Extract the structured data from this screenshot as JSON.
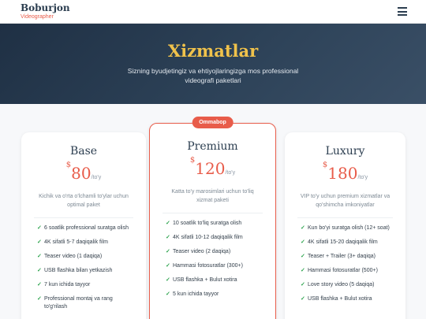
{
  "brand": {
    "name": "Boburjon",
    "tagline": "Videographer"
  },
  "header": {
    "menu_icon": "hamburger-menu-icon"
  },
  "hero": {
    "title": "Xizmatlar",
    "subtitle": "Sizning byudjetingiz va ehtiyojlaringizga mos professional videografi paketlari"
  },
  "colors": {
    "accent": "#e85c4a",
    "title_gold": "#f0c24b",
    "hero_bg": "#2d4258",
    "check": "#2ea44f"
  },
  "plans": [
    {
      "name": "Base",
      "currency": "$",
      "price": "80",
      "period": "/to'y",
      "description": "Kichik va o'rta o'lchamli to'ylar uchun optimal paket",
      "features": [
        "6 soatlik professional suratga olish",
        "4K sifatli 5-7 daqiqalik film",
        "Teaser video (1 daqiqa)",
        "USB flashka bilan yetkazish",
        "7 kun ichida tayyor",
        "Professional montaj va rang to'g'rilash"
      ]
    },
    {
      "name": "Premium",
      "badge": "Ommabop",
      "currency": "$",
      "price": "120",
      "period": "/to'y",
      "description": "Katta to'y marosimlari uchun to'liq xizmat paketi",
      "features": [
        "10 soatlik to'liq suratga olish",
        "4K sifatli 10-12 daqiqalik film",
        "Teaser video (2 daqiqa)",
        "Hammasi fotosuratlar (300+)",
        "USB flashka + Bulut xotira",
        "5 kun ichida tayyor"
      ]
    },
    {
      "name": "Luxury",
      "currency": "$",
      "price": "180",
      "period": "/to'y",
      "description": "VIP to'y uchun premium xizmatlar va qo'shimcha imkoniyatlar",
      "features": [
        "Kun bo'yi suratga olish (12+ soat)",
        "4K sifatli 15-20 daqiqalik film",
        "Teaser + Trailer (3+ daqiqa)",
        "Hammasi fotosuratlar (500+)",
        "Love story video (5 daqiqa)",
        "USB flashka + Bulut xotira"
      ]
    }
  ]
}
